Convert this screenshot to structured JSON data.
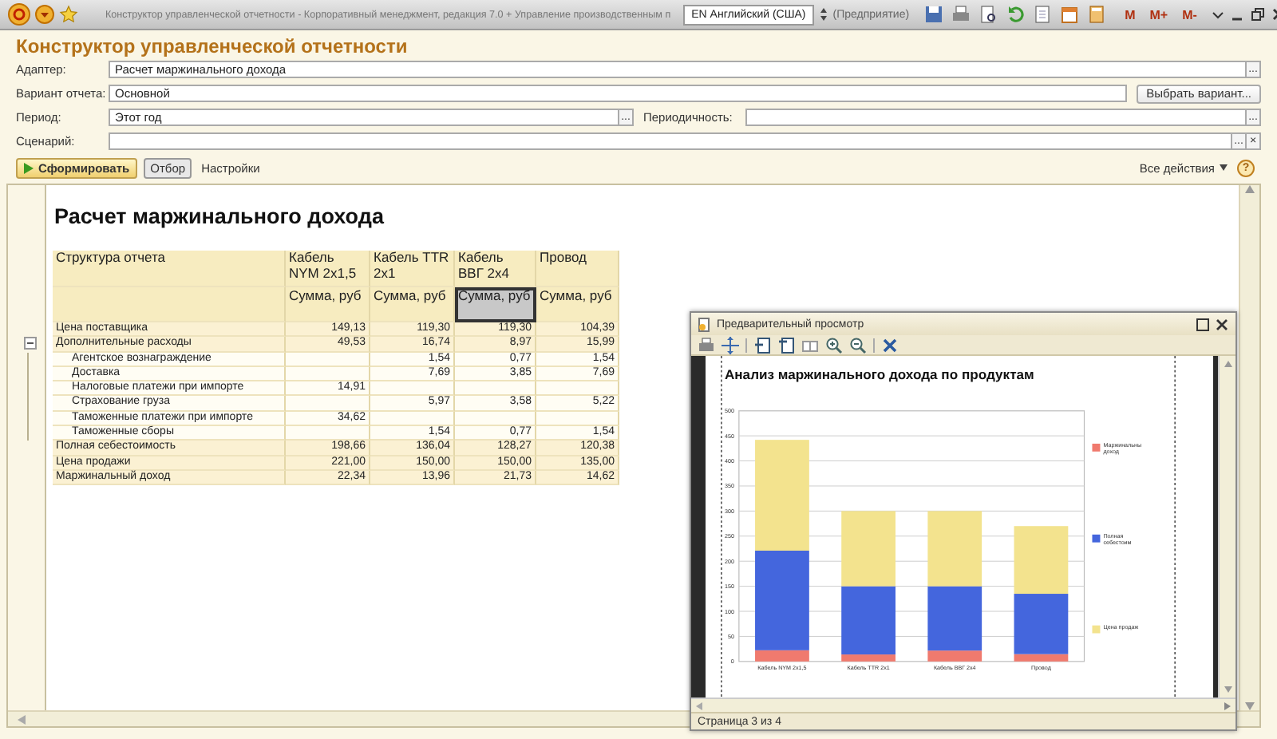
{
  "app_bar": {
    "tab_title": "Конструктор управленческой отчетности - Корпоративный менеджмент, редакция 7.0 + Управление производственным п",
    "language": "EN Английский (США)",
    "mode": "(Предприятие)",
    "memory_buttons": [
      "M",
      "M+",
      "M-"
    ]
  },
  "window": {
    "title": "Конструктор управленческой отчетности"
  },
  "form": {
    "adapter": {
      "label": "Адаптер:",
      "value": "Расчет маржинального дохода",
      "buttons": [
        "..."
      ]
    },
    "variant": {
      "label": "Вариант отчета:",
      "value": "Основной",
      "button": "Выбрать вариант..."
    },
    "period": {
      "label": "Период:",
      "value": "Этот год",
      "buttons": [
        "..."
      ]
    },
    "periodicity": {
      "label": "Периодичность:",
      "buttons": [
        "..."
      ]
    },
    "scenario": {
      "label": "Сценарий:",
      "buttons": [
        "...",
        "×"
      ]
    }
  },
  "toolbar": {
    "generate": "Сформировать",
    "filter": "Отбор",
    "settings": "Настройки",
    "all_actions": "Все действия",
    "help": "?"
  },
  "report": {
    "title": "Расчет маржинального дохода",
    "columns": [
      "Структура отчета",
      "Кабель NYM 2x1,5",
      "Кабель TTR 2x1",
      "Кабель ВВГ 2x4",
      "Провод"
    ],
    "subheader": [
      {
        "text": "Сумма, руб",
        "selected": false
      },
      {
        "text": "Сумма, руб",
        "selected": false
      },
      {
        "text": "Сумма, руб",
        "selected": true
      },
      {
        "text": "Сумма, руб",
        "selected": false
      }
    ],
    "rows": [
      {
        "label": "Цена поставщика",
        "values": {
          "1": "149,13",
          "2": "119,30",
          "3": "119,30",
          "4": "104,39"
        }
      },
      {
        "label": "Дополнительные расходы",
        "expanded": true,
        "values": {
          "1": "49,53",
          "2": "16,74",
          "3": "8,97",
          "4": "15,99"
        },
        "children": [
          {
            "label": "Агентское вознаграждение",
            "values": {
              "2": "1,54",
              "3": "0,77",
              "4": "1,54"
            }
          },
          {
            "label": "Доставка",
            "values": {
              "2": "7,69",
              "3": "3,85",
              "4": "7,69"
            }
          },
          {
            "label": "Налоговые платежи при импорте",
            "values": {
              "1": "14,91"
            }
          },
          {
            "label": "Страхование груза",
            "values": {
              "2": "5,97",
              "3": "3,58",
              "4": "5,22"
            }
          },
          {
            "label": "Таможенные платежи при импорте",
            "values": {
              "1": "34,62"
            }
          },
          {
            "label": "Таможенные сборы",
            "values": {
              "2": "1,54",
              "3": "0,77",
              "4": "1,54"
            }
          }
        ]
      },
      {
        "label": "Полная себестоимость",
        "values": {
          "1": "198,66",
          "2": "136,04",
          "3": "128,27",
          "4": "120,38"
        }
      },
      {
        "label": "Цена продажи",
        "values": {
          "1": "221,00",
          "2": "150,00",
          "3": "150,00",
          "4": "135,00"
        }
      },
      {
        "label": "Маржинальный доход",
        "values": {
          "1": "22,34",
          "2": "13,96",
          "3": "21,73",
          "4": "14,62"
        }
      }
    ]
  },
  "preview": {
    "title": "Предварительный просмотр",
    "status": "Страница 3 из 4",
    "chart_data": {
      "type": "bar",
      "title": "Анализ маржинального дохода по продуктам",
      "stacked": true,
      "grid": true,
      "legend": true,
      "categories": [
        "Кабель NYM 2x1,5",
        "Кабель TTR 2x1",
        "Кабель ВВГ 2x4",
        "Провод"
      ],
      "ylim": [
        0,
        500
      ],
      "yticks": [
        0,
        50,
        100,
        150,
        200,
        250,
        300,
        350,
        400,
        450,
        500
      ],
      "series": [
        {
          "name": "Маржинальны доход",
          "color": "#f07a6e",
          "values": [
            22.34,
            13.96,
            21.73,
            14.62
          ]
        },
        {
          "name": "Полная себестоим",
          "color": "#4466dd",
          "values": [
            198.66,
            136.04,
            128.27,
            120.38
          ]
        },
        {
          "name": "Цена продаж",
          "color": "#f3e38e",
          "values": [
            221,
            150,
            150,
            135
          ]
        }
      ]
    }
  }
}
